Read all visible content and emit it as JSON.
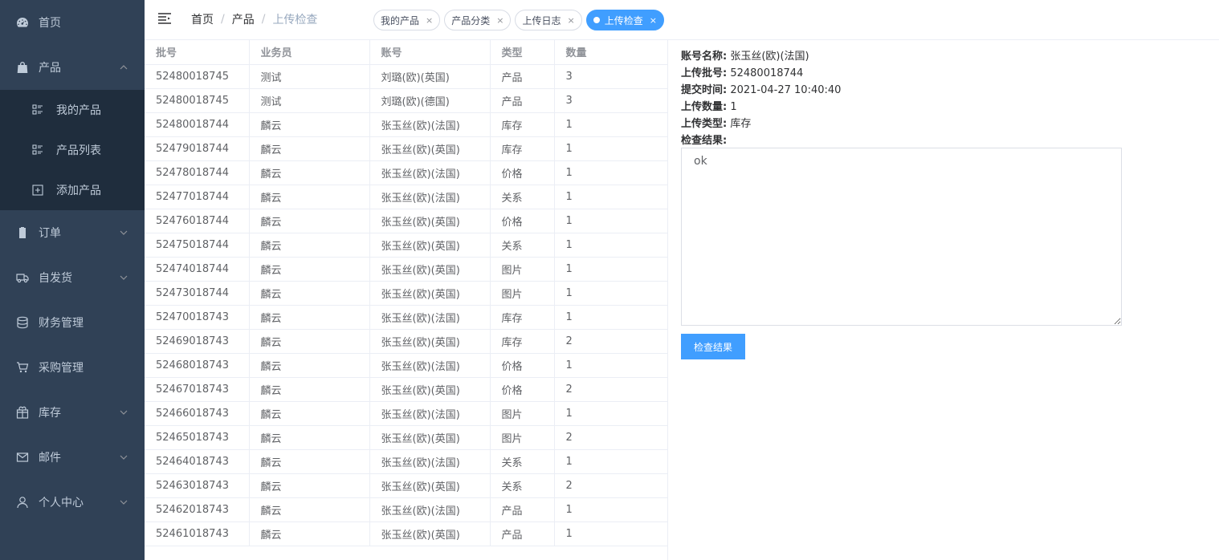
{
  "sidebar": {
    "items": [
      {
        "label": "首页",
        "icon": "dashboard-icon"
      },
      {
        "label": "产品",
        "icon": "shopping-bag-icon",
        "arrow": "chevron-up-icon"
      },
      {
        "label": "订单",
        "icon": "clipboard-icon",
        "arrow": "chevron-down-icon"
      },
      {
        "label": "自发货",
        "icon": "truck-icon",
        "arrow": "chevron-down-icon"
      },
      {
        "label": "财务管理",
        "icon": "database-icon"
      },
      {
        "label": "采购管理",
        "icon": "shopping-cart-icon"
      },
      {
        "label": "库存",
        "icon": "gift-box-icon",
        "arrow": "chevron-down-icon"
      },
      {
        "label": "邮件",
        "icon": "mail-icon",
        "arrow": "chevron-down-icon"
      },
      {
        "label": "个人中心",
        "icon": "user-icon",
        "arrow": "chevron-down-icon"
      }
    ],
    "submenu": [
      {
        "label": "我的产品",
        "icon": "list-icon"
      },
      {
        "label": "产品列表",
        "icon": "list-icon"
      },
      {
        "label": "添加产品",
        "icon": "add-square-icon"
      }
    ]
  },
  "header": {
    "breadcrumb": [
      "首页",
      "产品",
      "上传检查"
    ],
    "separator": "/",
    "tags": [
      {
        "label": "我的产品",
        "active": false
      },
      {
        "label": "产品分类",
        "active": false
      },
      {
        "label": "上传日志",
        "active": false
      },
      {
        "label": "上传检查",
        "active": true
      }
    ],
    "tag_close": "×"
  },
  "table": {
    "columns": [
      "批号",
      "业务员",
      "账号",
      "类型",
      "数量"
    ],
    "rows": [
      [
        "52480018745",
        "测试",
        "刘璐(欧)(英国)",
        "产品",
        "3"
      ],
      [
        "52480018745",
        "测试",
        "刘璐(欧)(德国)",
        "产品",
        "3"
      ],
      [
        "52480018744",
        "麟云",
        "张玉丝(欧)(法国)",
        "库存",
        "1"
      ],
      [
        "52479018744",
        "麟云",
        "张玉丝(欧)(英国)",
        "库存",
        "1"
      ],
      [
        "52478018744",
        "麟云",
        "张玉丝(欧)(法国)",
        "价格",
        "1"
      ],
      [
        "52477018744",
        "麟云",
        "张玉丝(欧)(法国)",
        "关系",
        "1"
      ],
      [
        "52476018744",
        "麟云",
        "张玉丝(欧)(英国)",
        "价格",
        "1"
      ],
      [
        "52475018744",
        "麟云",
        "张玉丝(欧)(英国)",
        "关系",
        "1"
      ],
      [
        "52474018744",
        "麟云",
        "张玉丝(欧)(英国)",
        "图片",
        "1"
      ],
      [
        "52473018744",
        "麟云",
        "张玉丝(欧)(英国)",
        "图片",
        "1"
      ],
      [
        "52470018743",
        "麟云",
        "张玉丝(欧)(法国)",
        "库存",
        "1"
      ],
      [
        "52469018743",
        "麟云",
        "张玉丝(欧)(英国)",
        "库存",
        "2"
      ],
      [
        "52468018743",
        "麟云",
        "张玉丝(欧)(法国)",
        "价格",
        "1"
      ],
      [
        "52467018743",
        "麟云",
        "张玉丝(欧)(英国)",
        "价格",
        "2"
      ],
      [
        "52466018743",
        "麟云",
        "张玉丝(欧)(法国)",
        "图片",
        "1"
      ],
      [
        "52465018743",
        "麟云",
        "张玉丝(欧)(英国)",
        "图片",
        "2"
      ],
      [
        "52464018743",
        "麟云",
        "张玉丝(欧)(法国)",
        "关系",
        "1"
      ],
      [
        "52463018743",
        "麟云",
        "张玉丝(欧)(英国)",
        "关系",
        "2"
      ],
      [
        "52462018743",
        "麟云",
        "张玉丝(欧)(法国)",
        "产品",
        "1"
      ],
      [
        "52461018743",
        "麟云",
        "张玉丝(欧)(英国)",
        "产品",
        "1"
      ]
    ]
  },
  "detail": {
    "fields": [
      {
        "key": "账号名称:",
        "value": "张玉丝(欧)(法国)"
      },
      {
        "key": "上传批号:",
        "value": "52480018744"
      },
      {
        "key": "提交时间:",
        "value": "2021-04-27 10:40:40"
      },
      {
        "key": "上传数量:",
        "value": "1"
      },
      {
        "key": "上传类型:",
        "value": "库存"
      },
      {
        "key": "检查结果:",
        "value": ""
      }
    ],
    "result_text": "ok",
    "button_label": "检查结果"
  },
  "colors": {
    "sidebar_bg": "#304156",
    "submenu_bg": "#1f2d3d",
    "accent": "#409eff"
  }
}
